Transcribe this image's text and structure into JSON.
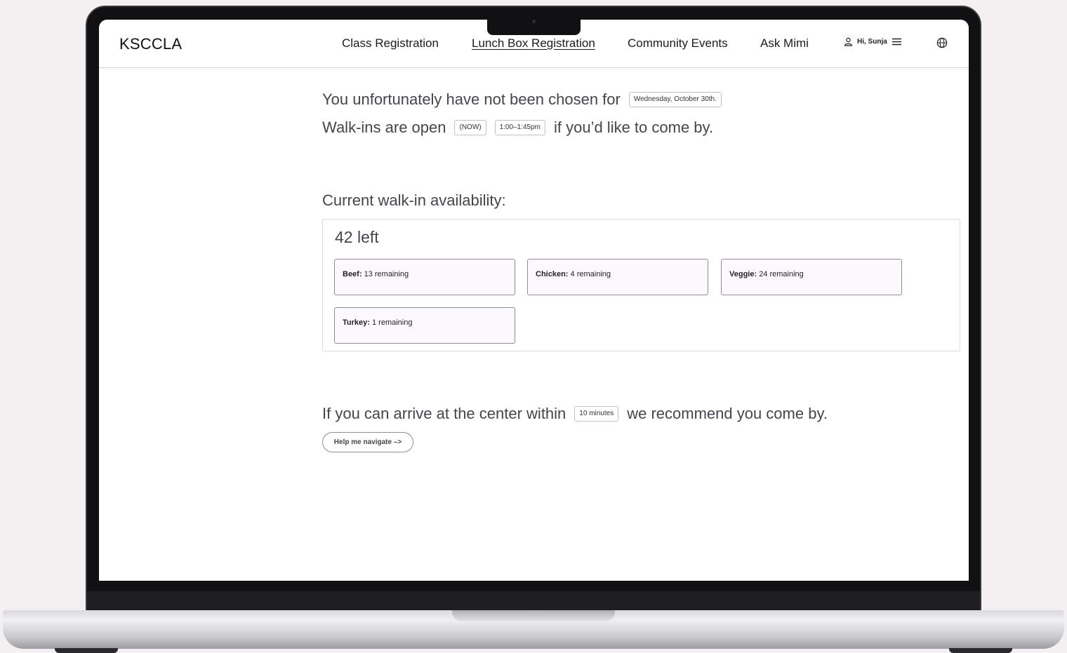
{
  "nav": {
    "logo": "KSCCLA",
    "links": [
      "Class Registration",
      "Lunch Box Registration",
      "Community Events",
      "Ask Mimi"
    ],
    "active_link": "Lunch Box Registration",
    "user_greeting": "Hi, Sunja",
    "icons": {
      "user": "user-icon",
      "menu": "hamburger-menu-icon",
      "language": "globe-icon"
    }
  },
  "status": {
    "not_chosen_text": "You unfortunately have not been chosen for",
    "date_chip": "Wednesday, October 30th.",
    "walkins_text": "Walk-ins are open",
    "now_chip": "(NOW)",
    "time_chip": "1:00–1:45pm",
    "walkins_suffix": "if you’d like to come by."
  },
  "availability": {
    "title": "Current walk-in availability:",
    "total_left": "42 left",
    "meals": [
      {
        "name": "Beef:",
        "remaining": "13 remaining"
      },
      {
        "name": "Chicken:",
        "remaining": "4 remaining"
      },
      {
        "name": "Veggie:",
        "remaining": "24 remaining"
      },
      {
        "name": "Turkey:",
        "remaining": "1 remaining"
      }
    ]
  },
  "arrival": {
    "prefix": "If you can arrive at the center within",
    "minutes_chip": "10 minutes",
    "suffix": "we recommend you come by.",
    "navigate_button": "Help me navigate –>"
  },
  "colors": {
    "card_fill": "#fcf8fd",
    "text": "#45454f",
    "frame": "#111114"
  }
}
